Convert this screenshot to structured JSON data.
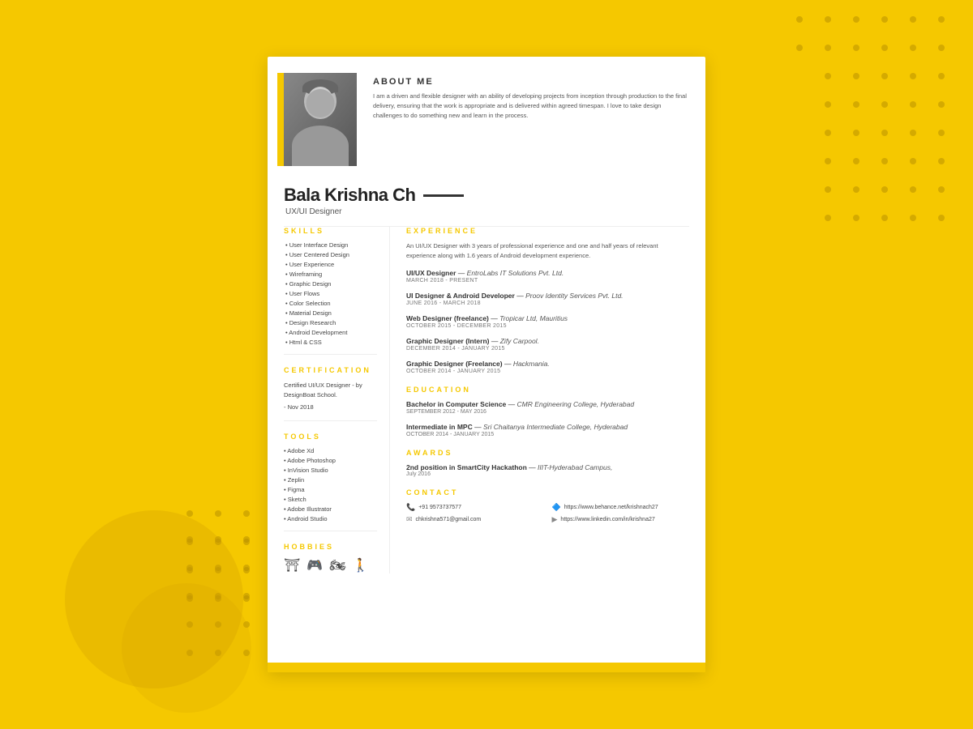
{
  "background": {
    "color": "#F5C800"
  },
  "header": {
    "about_title": "ABOUT  ME",
    "about_text": "I am a driven and flexible designer with an ability of developing projects from inception through production to the final delivery, ensuring that the work is appropriate and is delivered within agreed timespan. I love to take design challenges to do something new and learn in the process.",
    "name": "Bala Krishna Ch",
    "designation": "UX/UI Designer"
  },
  "skills": {
    "title": "SKILLS",
    "items": [
      "User Interface Design",
      "User Centered Design",
      "User Experience",
      "Wireframing",
      "Graphic Design",
      "User Flows",
      "Color Selection",
      "Material Design",
      "Design Research",
      "Android Development",
      "Html & CSS"
    ]
  },
  "certification": {
    "title": "CERTIFICATiON",
    "text": "Certified UI/UX Designer - by DesignBoat School.",
    "date": "- Nov 2018"
  },
  "tools": {
    "title": "TOOLS",
    "items": [
      "Adobe Xd",
      "Adobe Photoshop",
      "InVision Studio",
      "Zeplin",
      "Figma",
      "Sketch",
      "Adobe Illustrator",
      "Android Studio"
    ]
  },
  "hobbies": {
    "title": "HOBBIES",
    "icons": [
      "⛩",
      "🎮",
      "🏍",
      "🚶"
    ]
  },
  "experience": {
    "title": "EXPERIENCE",
    "intro": "An UI/UX Designer with 3 years of professional experience and one and half years of relevant experience along with 1.6 years of Android development experience.",
    "items": [
      {
        "role": "UI/UX Designer",
        "company": "EntroLabs IT Solutions Pvt. Ltd.",
        "date": "March 2018 - PRESENT"
      },
      {
        "role": "UI Designer & Android Developer",
        "company": "Proov Identity Services Pvt. Ltd.",
        "date": "June 2016 - March 2018"
      },
      {
        "role": "Web Designer (freelance)",
        "company": "Tropicar Ltd, Mauritius",
        "date": "October 2015 - December 2015"
      },
      {
        "role": "Graphic Designer (Intern)",
        "company": "Zify Carpool.",
        "date": "December 2014 - January 2015"
      },
      {
        "role": "Graphic Designer (Freelance)",
        "company": "Hackmania.",
        "date": "October 2014 - January 2015"
      }
    ]
  },
  "education": {
    "title": "EDUCATION",
    "items": [
      {
        "degree": "Bachelor in Computer Science",
        "institution": "CMR Engineering College, Hyderabad",
        "date": "September 2012 - May 2016"
      },
      {
        "degree": "Intermediate in MPC",
        "institution": "Sri Chaitanya Intermediate College, Hyderabad",
        "date": "October 2014 - January 2015"
      }
    ]
  },
  "awards": {
    "title": "AWARDS",
    "items": [
      {
        "title": "2nd position in SmartCity Hackathon",
        "institution": "IIIT-Hyderabad Campus,",
        "date": "July 2016"
      }
    ]
  },
  "contact": {
    "title": "CONTACT",
    "items": [
      {
        "icon": "phone",
        "value": "+91 9573737577"
      },
      {
        "icon": "behance",
        "value": "https://www.behance.net/krishnach27"
      },
      {
        "icon": "email",
        "value": "chkrishna571@gmail.com"
      },
      {
        "icon": "linkedin",
        "value": "https://www.linkedin.com/in/krishna27"
      }
    ]
  }
}
